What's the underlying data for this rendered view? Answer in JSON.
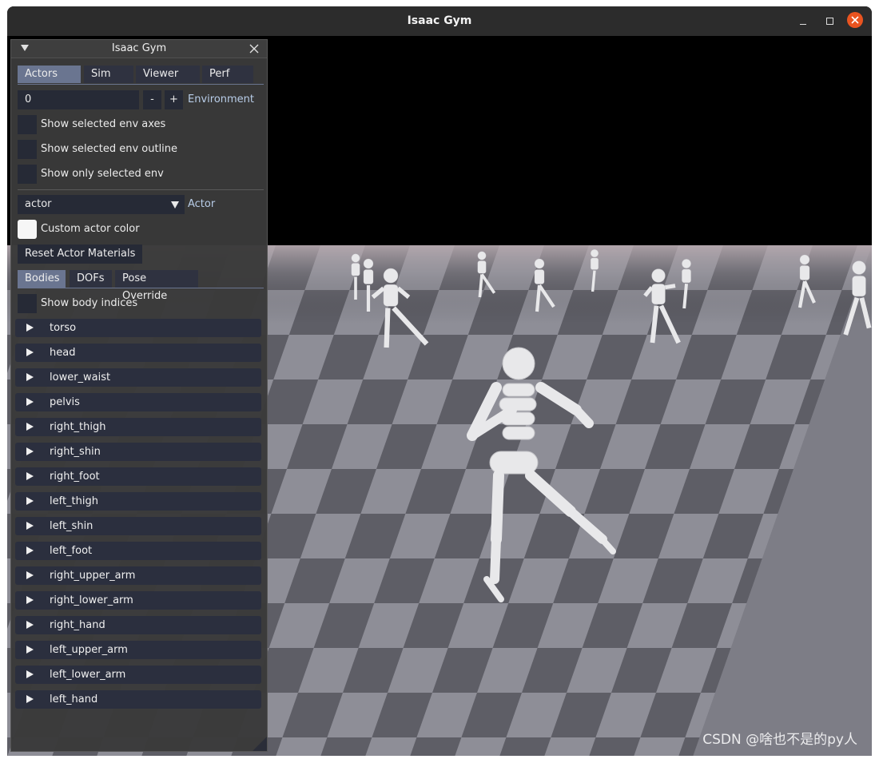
{
  "window": {
    "title": "Isaac Gym"
  },
  "panel": {
    "title": "Isaac Gym",
    "tabs": [
      "Actors",
      "Sim",
      "Viewer",
      "Perf"
    ],
    "environment": {
      "value": "0",
      "minus": "-",
      "plus": "+",
      "label": "Environment"
    },
    "env_options": [
      "Show selected env axes",
      "Show selected env outline",
      "Show only selected env"
    ],
    "actor": {
      "value": "actor",
      "label": "Actor"
    },
    "custom_color_label": "Custom actor color",
    "reset_materials_label": "Reset Actor Materials",
    "subtabs": [
      "Bodies",
      "DOFs",
      "Pose Override"
    ],
    "show_body_indices_label": "Show body indices",
    "bodies": [
      "torso",
      "head",
      "lower_waist",
      "pelvis",
      "right_thigh",
      "right_shin",
      "right_foot",
      "left_thigh",
      "left_shin",
      "left_foot",
      "right_upper_arm",
      "right_lower_arm",
      "right_hand",
      "left_upper_arm",
      "left_lower_arm",
      "left_hand"
    ]
  },
  "colors": {
    "tab_active": "#6a7590",
    "widget_bg": "#262a36",
    "accent_close": "#e95420",
    "sky": "#000000",
    "floor_light": "#8f8f98",
    "floor_dark": "#5c5c64"
  },
  "watermark": "CSDN @啥也不是的py人"
}
